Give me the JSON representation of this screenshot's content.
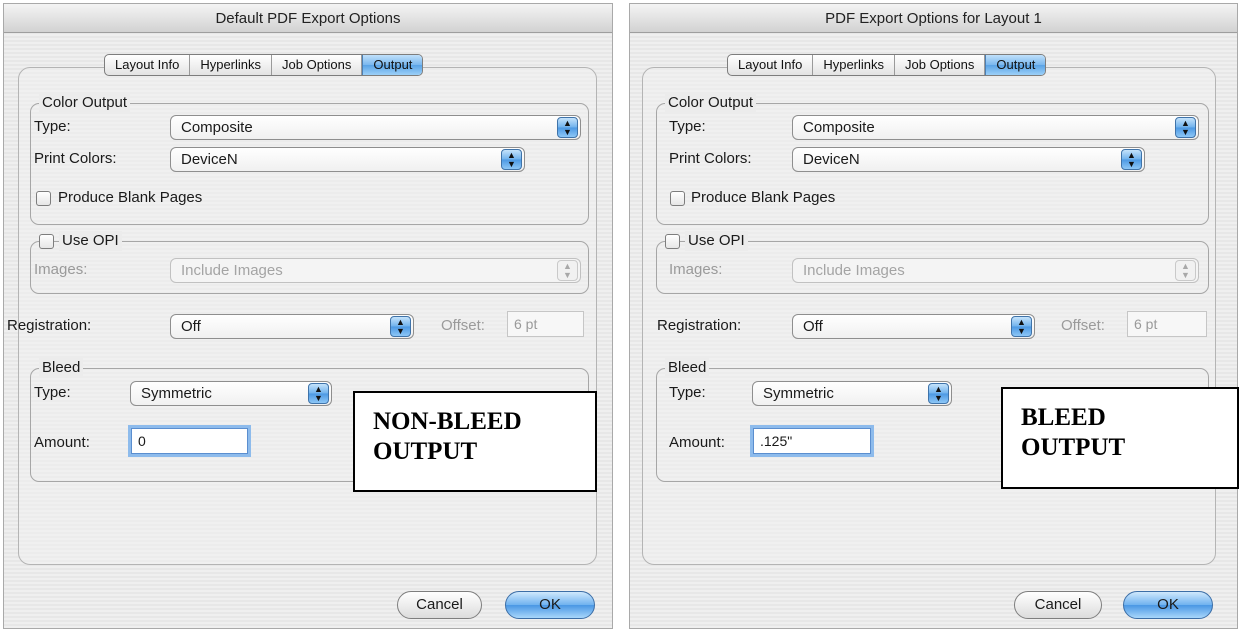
{
  "left": {
    "title": "Default PDF Export Options",
    "tabs": [
      "Layout Info",
      "Hyperlinks",
      "Job Options",
      "Output"
    ],
    "color_output": {
      "legend": "Color Output",
      "type_label": "Type:",
      "type_value": "Composite",
      "print_colors_label": "Print Colors:",
      "print_colors_value": "DeviceN",
      "blank_pages_label": "Produce Blank Pages"
    },
    "opi": {
      "legend": "Use OPI",
      "images_label": "Images:",
      "images_value": "Include Images"
    },
    "registration": {
      "label": "Registration:",
      "value": "Off",
      "offset_label": "Offset:",
      "offset_value": "6 pt"
    },
    "bleed": {
      "legend": "Bleed",
      "type_label": "Type:",
      "type_value": "Symmetric",
      "amount_label": "Amount:",
      "amount_value": "0"
    },
    "buttons": {
      "cancel": "Cancel",
      "ok": "OK"
    },
    "annotation": [
      "NON-BLEED",
      "OUTPUT"
    ]
  },
  "right": {
    "title": "PDF Export Options for Layout 1",
    "tabs": [
      "Layout Info",
      "Hyperlinks",
      "Job Options",
      "Output"
    ],
    "color_output": {
      "legend": "Color Output",
      "type_label": "Type:",
      "type_value": "Composite",
      "print_colors_label": "Print Colors:",
      "print_colors_value": "DeviceN",
      "blank_pages_label": "Produce Blank Pages"
    },
    "opi": {
      "legend": "Use OPI",
      "images_label": "Images:",
      "images_value": "Include Images"
    },
    "registration": {
      "label": "Registration:",
      "value": "Off",
      "offset_label": "Offset:",
      "offset_value": "6 pt"
    },
    "bleed": {
      "legend": "Bleed",
      "type_label": "Type:",
      "type_value": "Symmetric",
      "amount_label": "Amount:",
      "amount_value": ".125\""
    },
    "buttons": {
      "cancel": "Cancel",
      "ok": "OK"
    },
    "annotation": [
      "BLEED",
      "OUTPUT"
    ]
  }
}
